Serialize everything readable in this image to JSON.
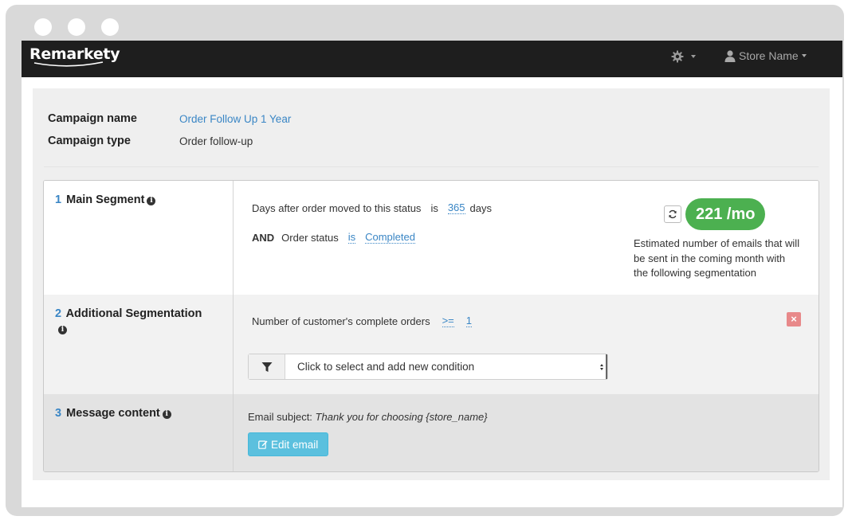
{
  "app": {
    "brand": "Remarkety",
    "user_menu_label": "Store Name",
    "icons": {
      "settings": "gear-icon",
      "user": "user-icon"
    }
  },
  "campaign": {
    "name_label": "Campaign name",
    "name_value": "Order Follow Up 1 Year",
    "type_label": "Campaign type",
    "type_value": "Order follow-up"
  },
  "segments": [
    {
      "number": "1",
      "title": "Main Segment",
      "conditions": [
        {
          "prefix": "",
          "field": "Days after order moved to this status",
          "operator": "is",
          "value": "365",
          "suffix": "days"
        },
        {
          "prefix": "AND",
          "field": "Order status",
          "operator": "is",
          "value": "Completed",
          "suffix": ""
        }
      ],
      "estimate": {
        "value": "221 /mo",
        "description": "Estimated number of emails that will be sent in the coming month with the following segmentation"
      }
    },
    {
      "number": "2",
      "title": "Additional Segmentation",
      "conditions": [
        {
          "field": "Number of customer's complete orders",
          "operator": ">=",
          "value": "1"
        }
      ],
      "delete_label": "×",
      "add_condition_placeholder": "Click to select and add new condition"
    },
    {
      "number": "3",
      "title": "Message content",
      "email_subject_label": "Email subject:",
      "email_subject_value": "Thank you for choosing {store_name}",
      "edit_button_label": "Edit email"
    }
  ],
  "colors": {
    "navbar": "#1e1e1e",
    "link": "#3a86c5",
    "estimate_badge": "#4cb050",
    "delete": "#e8898a",
    "edit_button": "#5bc0de"
  }
}
